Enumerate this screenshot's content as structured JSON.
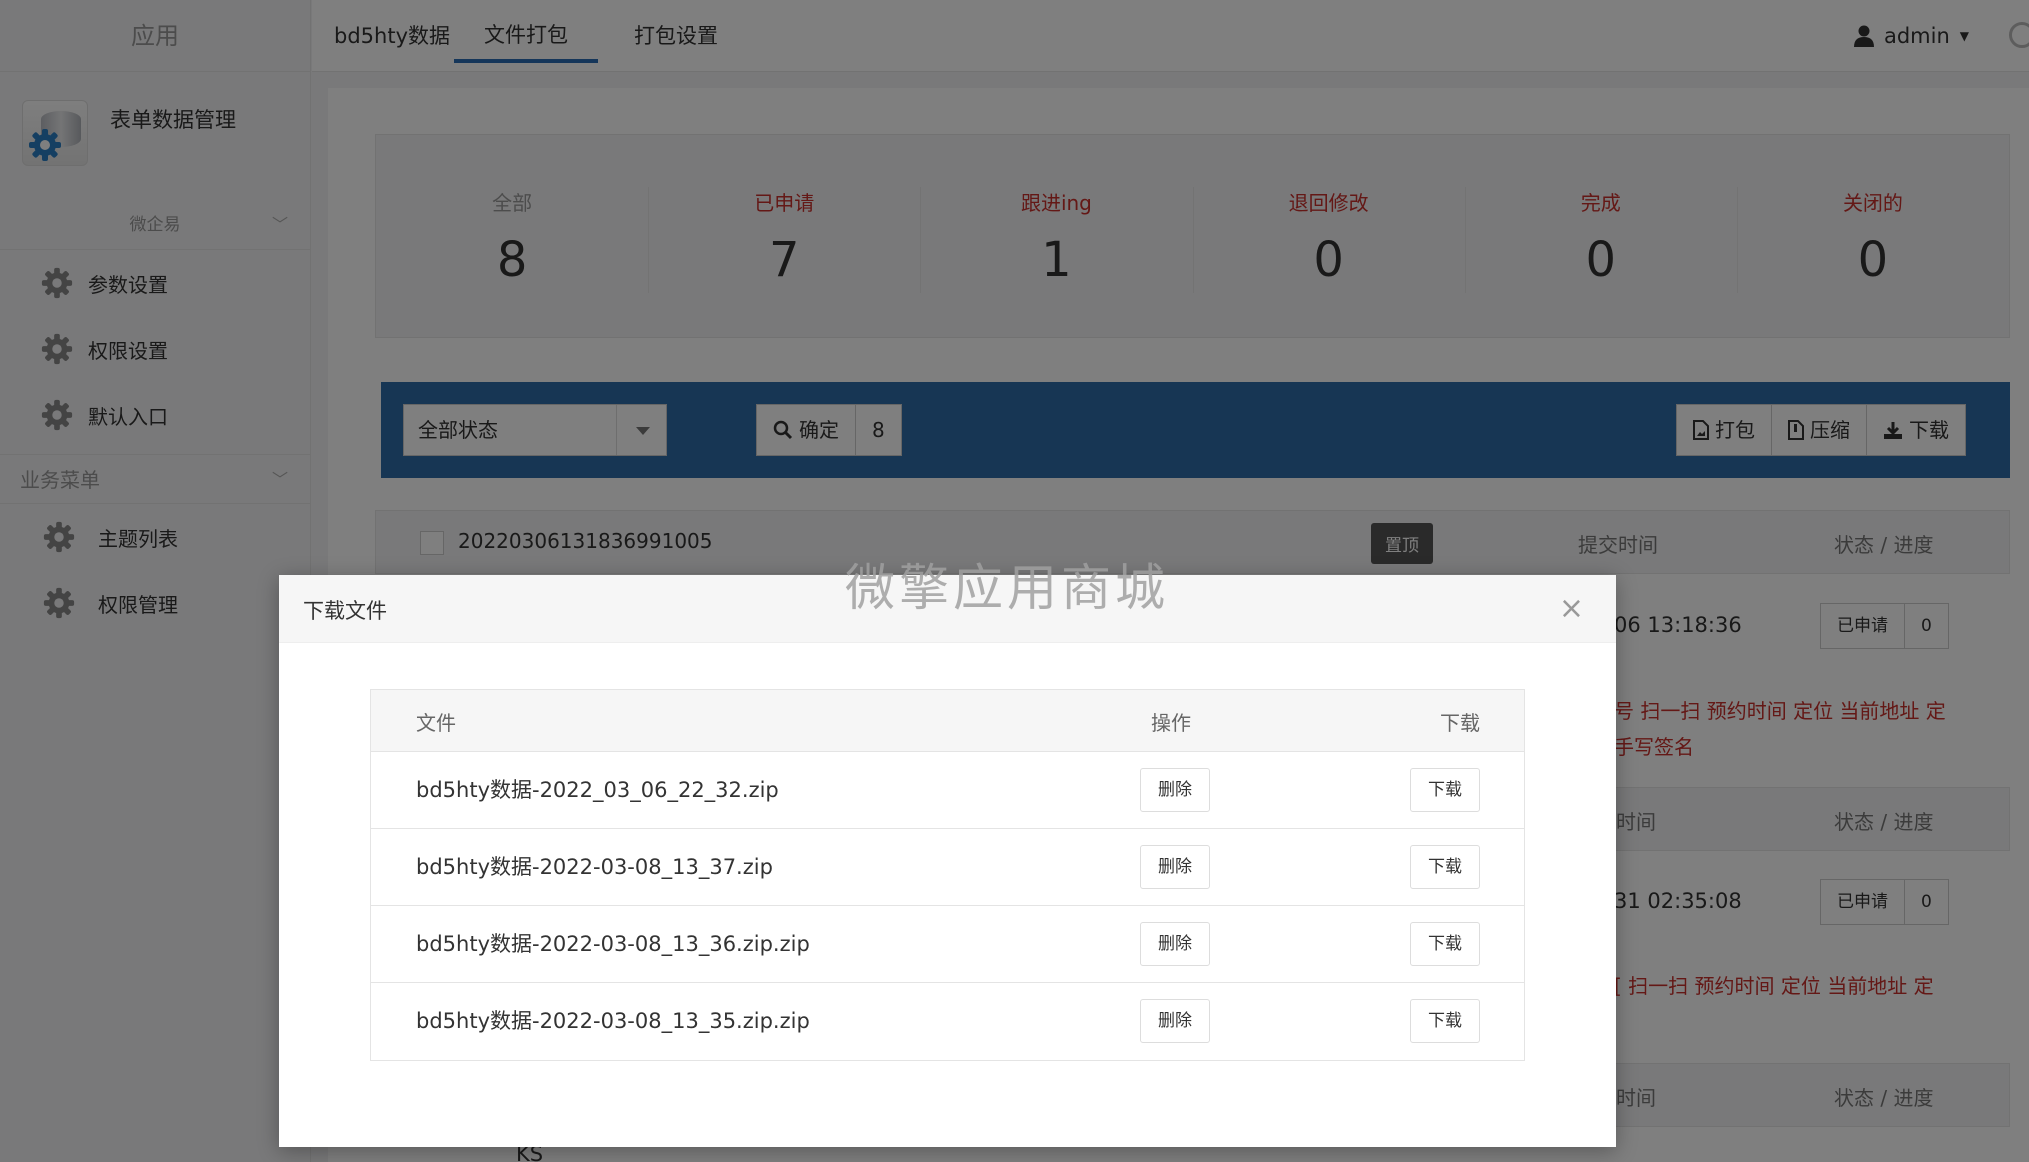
{
  "sidebar": {
    "app_label": "应用",
    "module_title": "表单数据管理",
    "group1": "微企易",
    "group1_items": [
      "参数设置",
      "权限设置",
      "默认入口"
    ],
    "group2": "业务菜单",
    "group2_items": [
      "主题列表",
      "权限管理"
    ]
  },
  "topnav": {
    "tabs": [
      "bd5hty数据",
      "文件打包",
      "打包设置"
    ],
    "active_tab": "文件打包",
    "user": "admin"
  },
  "stats": [
    {
      "label": "全部",
      "value": "8"
    },
    {
      "label": "已申请",
      "value": "7"
    },
    {
      "label": "跟进ing",
      "value": "1"
    },
    {
      "label": "退回修改",
      "value": "0"
    },
    {
      "label": "完成",
      "value": "0"
    },
    {
      "label": "关闭的",
      "value": "0"
    }
  ],
  "toolbar": {
    "status_select": "全部状态",
    "confirm_label": "确定",
    "confirm_count": "8",
    "pack_label": "打包",
    "compress_label": "压缩",
    "download_label": "下载"
  },
  "record": {
    "id": "20220306131836991005",
    "pin_label": "置顶",
    "col_time": "提交时间",
    "col_status": "状态 / 进度",
    "time1": "06 13:18:36",
    "status1": "已申请",
    "progress1": "0",
    "red1_line1": "号 扫一扫 预约时间 定位 当前地址 定",
    "red1_line2": "手写签名",
    "col_time_partial": "时间",
    "time2": "31 02:35:08",
    "status2": "已申请",
    "progress2": "0",
    "red2_line1": "[ 扫一扫 预约时间 定位 当前地址 定",
    "ks": "KS"
  },
  "modal": {
    "title": "下载文件",
    "close": "×",
    "col_file": "文件",
    "col_action": "操作",
    "col_download": "下载",
    "delete_label": "删除",
    "download_label": "下载",
    "files": [
      "bd5hty数据-2022_03_06_22_32.zip",
      "bd5hty数据-2022-03-08_13_37.zip",
      "bd5hty数据-2022-03-08_13_36.zip.zip",
      "bd5hty数据-2022-03-08_13_35.zip.zip"
    ]
  },
  "watermark": "微擎应用商城",
  "colors": {
    "toolbar": "#2f6da8",
    "red": "#c9302c",
    "active_tab": "#2a6db5"
  }
}
